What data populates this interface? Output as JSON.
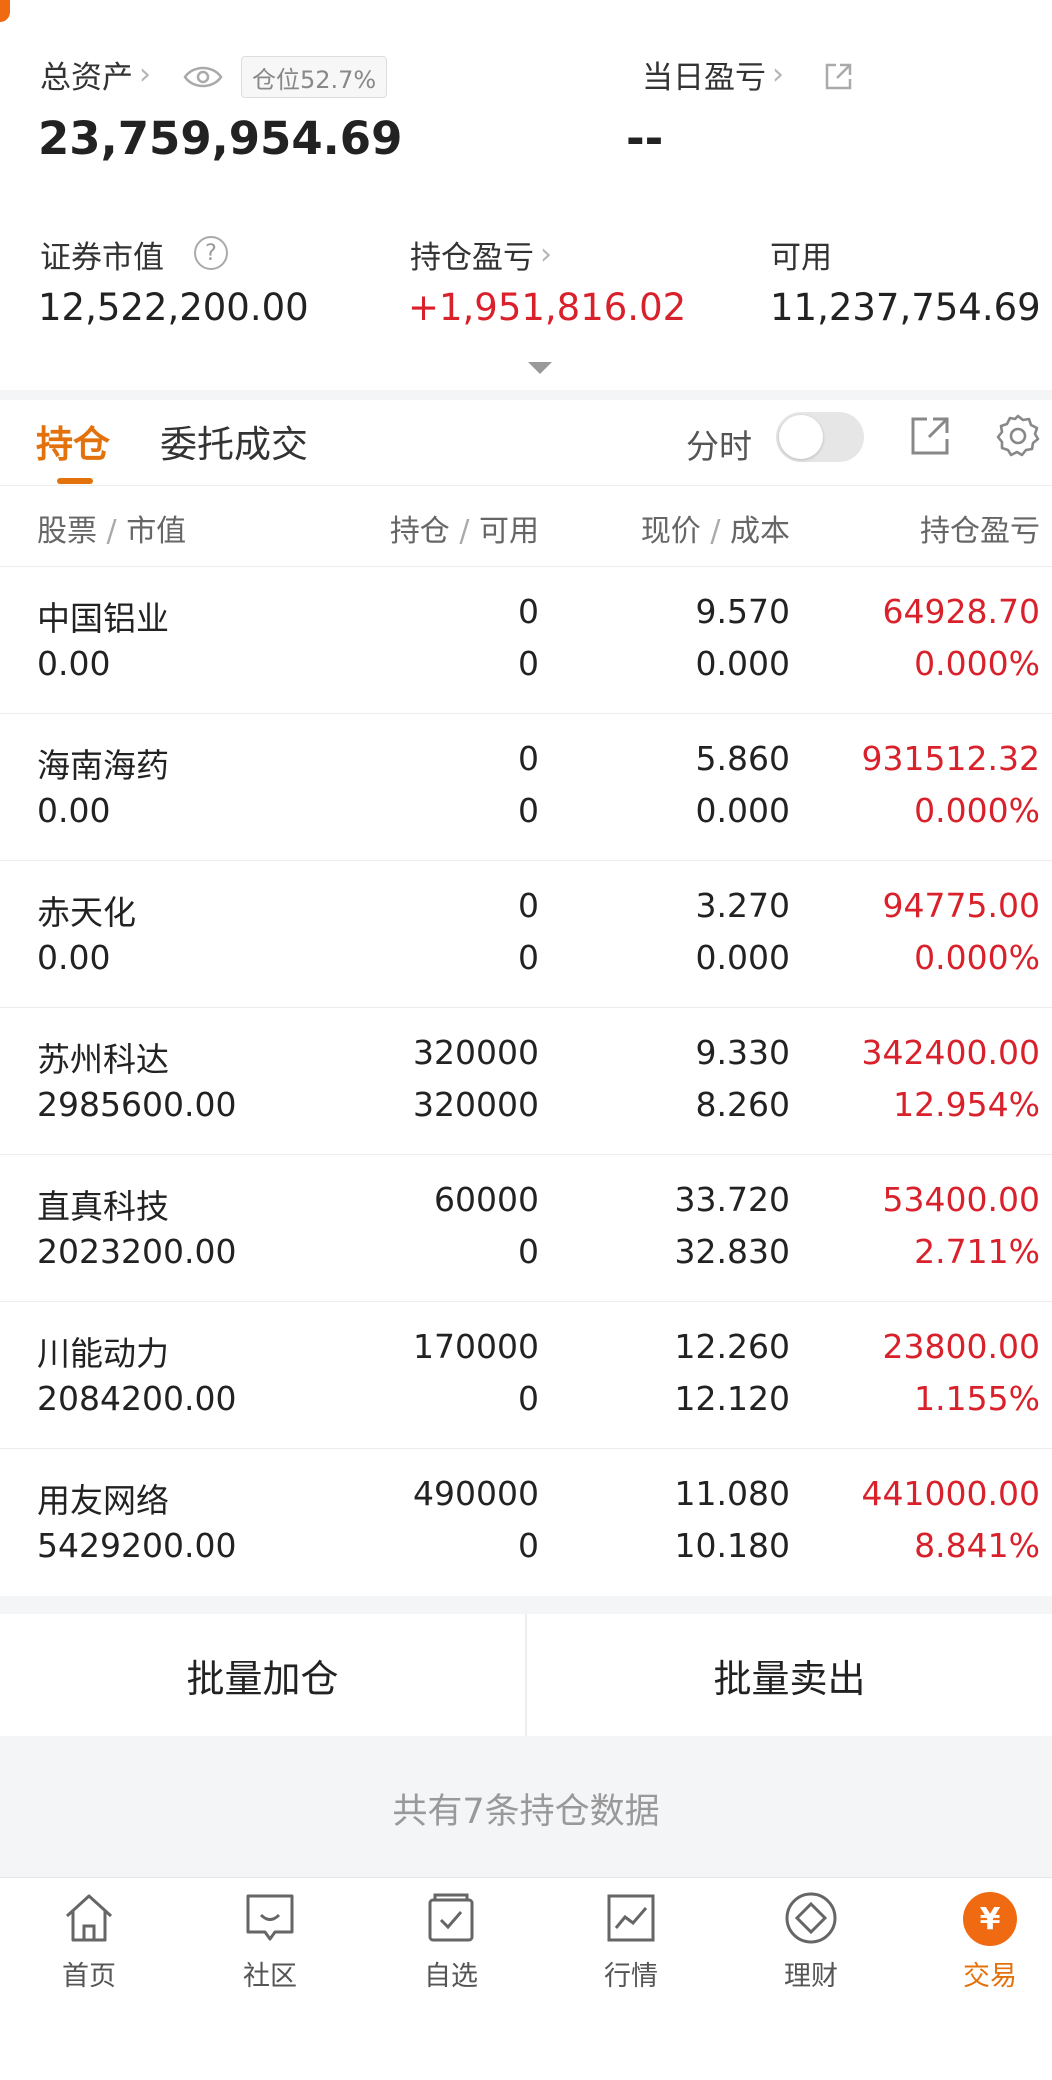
{
  "summary": {
    "total_assets_label": "总资产",
    "position_ratio": "仓位52.7%",
    "total_assets_value": "23,759,954.69",
    "daily_pl_label": "当日盈亏",
    "daily_pl_value": "--",
    "market_value_label": "证券市值",
    "market_value": "12,522,200.00",
    "holding_pl_label": "持仓盈亏",
    "holding_pl_value": "+1,951,816.02",
    "available_label": "可用",
    "available_value": "11,237,754.69"
  },
  "tabs": [
    {
      "label": "持仓",
      "active": true
    },
    {
      "label": "委托成交",
      "active": false
    }
  ],
  "toolbar": {
    "timeshare_label": "分时",
    "timeshare_on": false
  },
  "table": {
    "headers": {
      "stock": "股票",
      "market_value": "市值",
      "position": "持仓",
      "available": "可用",
      "price": "现价",
      "cost": "成本",
      "pl": "持仓盈亏"
    },
    "rows": [
      {
        "name": "中国铝业",
        "market_value": "0.00",
        "position": "0",
        "available": "0",
        "price": "9.570",
        "cost": "0.000",
        "pl": "64928.70",
        "pl_pct": "0.000%"
      },
      {
        "name": "海南海药",
        "market_value": "0.00",
        "position": "0",
        "available": "0",
        "price": "5.860",
        "cost": "0.000",
        "pl": "931512.32",
        "pl_pct": "0.000%"
      },
      {
        "name": "赤天化",
        "market_value": "0.00",
        "position": "0",
        "available": "0",
        "price": "3.270",
        "cost": "0.000",
        "pl": "94775.00",
        "pl_pct": "0.000%"
      },
      {
        "name": "苏州科达",
        "market_value": "2985600.00",
        "position": "320000",
        "available": "320000",
        "price": "9.330",
        "cost": "8.260",
        "pl": "342400.00",
        "pl_pct": "12.954%"
      },
      {
        "name": "直真科技",
        "market_value": "2023200.00",
        "position": "60000",
        "available": "0",
        "price": "33.720",
        "cost": "32.830",
        "pl": "53400.00",
        "pl_pct": "2.711%"
      },
      {
        "name": "川能动力",
        "market_value": "2084200.00",
        "position": "170000",
        "available": "0",
        "price": "12.260",
        "cost": "12.120",
        "pl": "23800.00",
        "pl_pct": "1.155%"
      },
      {
        "name": "用友网络",
        "market_value": "5429200.00",
        "position": "490000",
        "available": "0",
        "price": "11.080",
        "cost": "10.180",
        "pl": "441000.00",
        "pl_pct": "8.841%"
      }
    ]
  },
  "actions": {
    "batch_add": "批量加仓",
    "batch_sell": "批量卖出"
  },
  "footer_text": "共有7条持仓数据",
  "nav": [
    {
      "label": "首页",
      "icon": "home-icon"
    },
    {
      "label": "社区",
      "icon": "chat-icon"
    },
    {
      "label": "自选",
      "icon": "watchlist-icon"
    },
    {
      "label": "行情",
      "icon": "chart-icon"
    },
    {
      "label": "理财",
      "icon": "diamond-icon"
    },
    {
      "label": "交易",
      "icon": "trade-icon",
      "active": true,
      "glyph": "¥"
    }
  ],
  "colors": {
    "accent": "#e3720c",
    "loss_gain_red": "#d9212b"
  }
}
